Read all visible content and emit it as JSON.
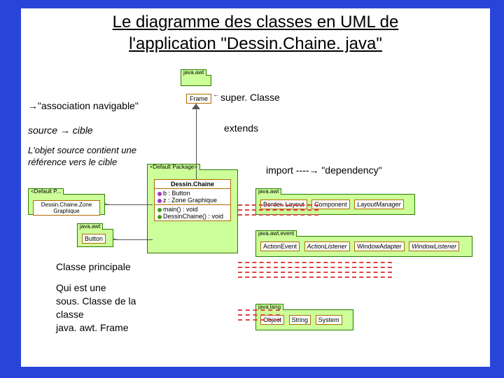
{
  "title_line1": "Le diagramme des classes en UML de",
  "title_line2": "l'application \"Dessin.Chaine. java\"",
  "annot_assoc": "→\"association  navigable\"",
  "annot_source_cible": "source   → cible",
  "annot_objet_line1": "L'objet source contient une",
  "annot_objet_line2": "référence vers le cible",
  "annot_super": "super. Classe",
  "annot_extends": "extends",
  "annot_import": "import   ----→  \"dependency\"",
  "annot_principale": "Classe principale",
  "annot_sous_l1": "Qui est une",
  "annot_sous_l2": "sous. Classe de la",
  "annot_sous_l3": "classe",
  "annot_sous_l4": "java. awt. Frame",
  "pkg_java_awt_top": "java.awt",
  "class_frame": "Frame",
  "pkg_default_left": "<Default P...",
  "class_zone_left": "Dessin.Chaine.Zone Graphique",
  "pkg_java_awt_left": "java.awt",
  "class_button_left": "Button",
  "pkg_default_mid": "<Default Package>",
  "class_dessin_name": "Dessin.Chaine",
  "attr_b": "b : Button",
  "attr_z": "z : Zone Graphique",
  "op_main": "main() : void",
  "op_ctor": "DessinChaine() : void",
  "pkg_java_awt_right": "java.awt",
  "class_border": "Border. Layout",
  "class_component": "Component",
  "class_layoutmgr": "LayoutManager",
  "pkg_java_awt_event": "java.awt.event",
  "class_actionevent": "ActionEvent",
  "class_actionlistener": "ActionListener",
  "class_windowadapter": "WindowAdapter",
  "class_windowlistener": "WindowListener",
  "pkg_java_lang": "java.lang",
  "class_object": "Object",
  "class_string": "String",
  "class_system": "System",
  "arrow_left": "←"
}
